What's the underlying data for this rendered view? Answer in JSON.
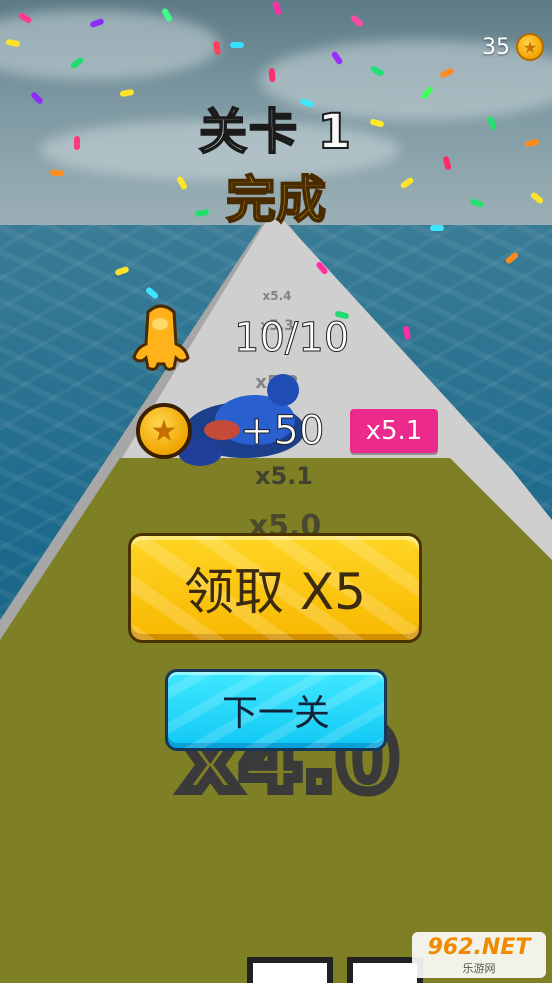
{
  "hud": {
    "coins": "35",
    "coin_icon": "coin-icon"
  },
  "level": {
    "title": "关卡 1",
    "subtitle": "完成"
  },
  "stats": {
    "collected": "10/10",
    "reward": "+50",
    "multiplier": "x5.1"
  },
  "road_marks": [
    "x5.1",
    "x5.0",
    "x4.0"
  ],
  "buttons": {
    "claim": "领取 X5",
    "next": "下一关"
  },
  "watermark": {
    "brand": "962.NET",
    "sub": "乐游网"
  },
  "colors": {
    "claim_button": "#ffd524",
    "next_button": "#11c8f4",
    "badge": "#ec2a8b",
    "done_text": "#ffd21f"
  }
}
